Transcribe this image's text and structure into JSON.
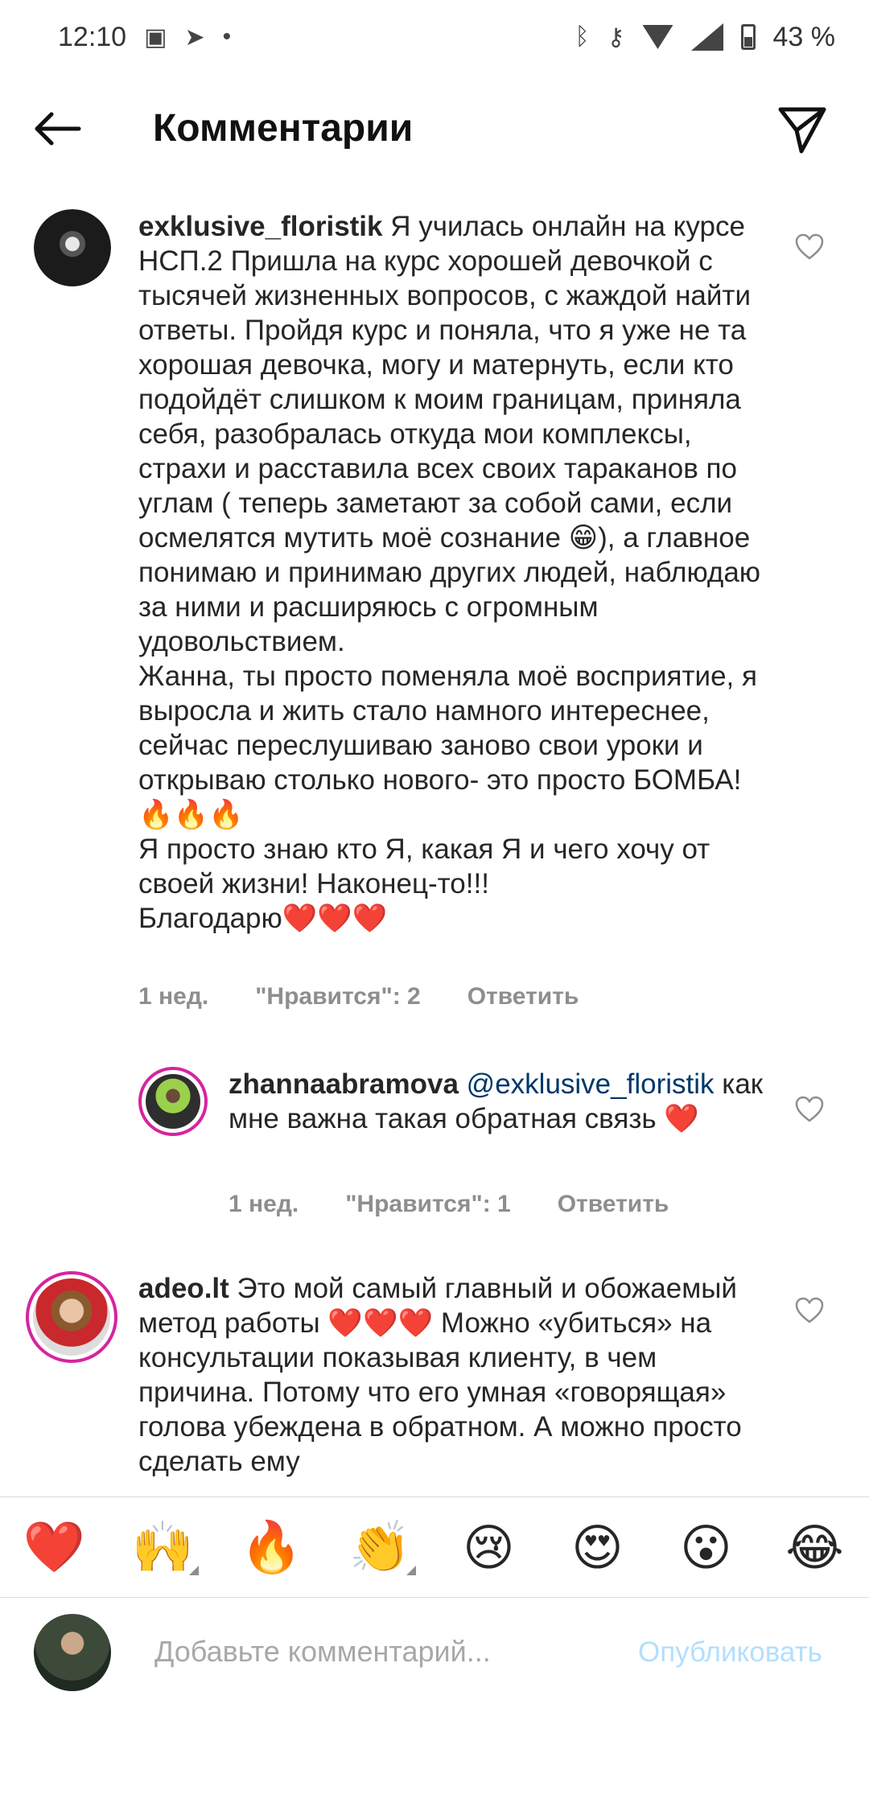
{
  "status_bar": {
    "time": "12:10",
    "battery": "43 %",
    "icons": [
      "gallery-icon",
      "telegram-icon",
      "dot-icon",
      "bluetooth-icon",
      "key-icon",
      "wifi-icon",
      "signal-icon",
      "battery-icon"
    ]
  },
  "header": {
    "title": "Комментарии",
    "back_icon": "arrow-left-icon",
    "send_icon": "paper-plane-icon"
  },
  "comments": [
    {
      "username": "exklusive_floristik",
      "text": "Я училась онлайн на курсе НСП.2 Пришла на курс хорошей девочкой с тысячей жизненных вопросов, с жаждой найти ответы. Пройдя курс и поняла, что я уже не та хорошая девочка, могу и матернуть, если кто подойдёт слишком к моим границам, приняла себя, разобралась откуда мои комплексы, страхи и расставила всех своих тараканов по углам ( теперь заметают за собой сами, если осмелятся мутить моё сознание 😁), а главное понимаю и принимаю других людей, наблюдаю за ними и расширяюсь с огромным удовольствием.\nЖанна, ты просто поменяла моё восприятие, я выросла и жить стало намного интереснее, сейчас переслушиваю заново свои уроки и открываю столько нового- это просто БОМБА! 🔥🔥🔥\nЯ просто знаю кто Я, какая Я и чего хочу от своей жизни! Наконец-то!!!\nБлагодарю❤️❤️❤️",
      "time": "1 нед.",
      "likes": "\"Нравится\": 2",
      "reply": "Ответить"
    },
    {
      "username": "zhannaabramova",
      "mention": "@exklusive_floristik",
      "text": "как мне важна такая обратная связь ❤️",
      "time": "1 нед.",
      "likes": "\"Нравится\": 1",
      "reply": "Ответить"
    },
    {
      "username": "adeo.lt",
      "text": "Это мой самый главный и обожаемый метод работы ❤️❤️❤️ Можно «убиться» на консультации показывая клиенту, в чем причина. Потому что его умная «говорящая» голова убеждена в обратном. А можно просто сделать ему"
    }
  ],
  "emoji_bar": [
    "❤️",
    "🙌",
    "🔥",
    "👏",
    "😢",
    "😍",
    "😮",
    "😂"
  ],
  "composer": {
    "placeholder": "Добавьте комментарий...",
    "publish": "Опубликовать"
  },
  "colors": {
    "text": "#262626",
    "muted": "#8e8e8e",
    "mention": "#00376b",
    "publish_disabled": "#b2dffc",
    "story_ring": "#d6249f"
  }
}
